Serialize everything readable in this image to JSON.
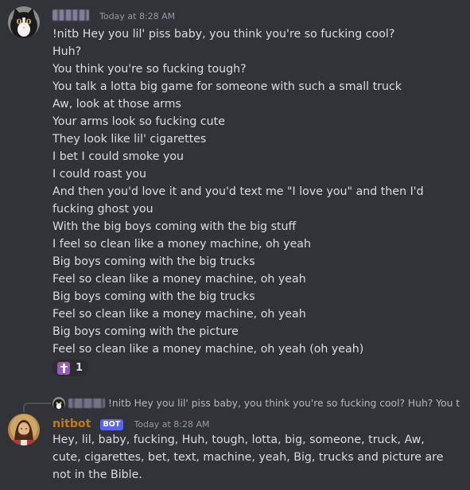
{
  "message1": {
    "timestamp": "Today at 8:28 AM",
    "lines": [
      "!nitb Hey you lil' piss baby, you think you're so fucking cool?",
      "Huh?",
      "You think you're so fucking tough?",
      "You talk a lotta big game for someone with such a small truck",
      "Aw, look at those arms",
      "Your arms look so fucking cute",
      "They look like lil' cigarettes",
      "I bet I could smoke you",
      "I could roast you",
      "And then you'd love it and you'd text me \"I love you\" and then I'd fucking ghost you",
      "With the big boys coming with the big stuff",
      "I feel so clean like a money machine, oh yeah",
      "Big boys coming with the big trucks",
      "Feel so clean like a money machine, oh yeah",
      "Big boys coming with the big trucks",
      "Feel so clean like a money machine, oh yeah",
      "Big boys coming with the picture",
      "Feel so clean like a money machine, oh yeah (oh yeah)"
    ],
    "reaction": {
      "emoji": "latin-cross-icon",
      "count": "1"
    }
  },
  "message2": {
    "reply_preview": "!nitb Hey you lil' piss baby, you think you're so fucking cool? Huh? You think",
    "username": "nitbot",
    "bot_tag": "BOT",
    "timestamp": "Today at 8:28 AM",
    "text": "Hey, lil, baby, fucking, Huh, tough, lotta, big, someone, truck, Aw, cute, cigarettes, bet, text, machine, yeah, Big, trucks and picture are not in the Bible.",
    "username_color": "#c27c0e"
  },
  "theme": {
    "background": "#313338",
    "text": "#dbdee1",
    "muted": "#949ba4",
    "bot_tag_bg": "#5865f2",
    "reaction_emoji_bg": "#9b59b6"
  }
}
